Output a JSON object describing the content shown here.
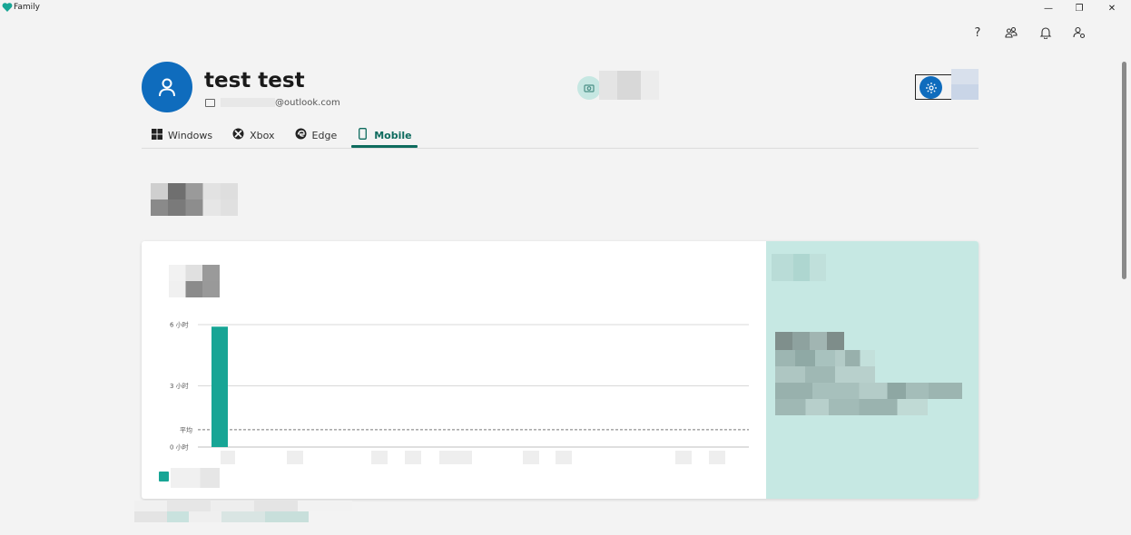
{
  "window": {
    "title": "Family",
    "minimize_glyph": "—",
    "restore_glyph": "❐",
    "close_glyph": "✕"
  },
  "top_icons": {
    "help_glyph": "?",
    "help": "help-icon",
    "family": "family-icon",
    "notifications": "bell-icon",
    "account": "account-settings-icon"
  },
  "profile": {
    "name": "test test",
    "email_suffix": "@outlook.com"
  },
  "tabs": [
    {
      "label": "Windows",
      "icon": "windows-icon",
      "glyph": "⊞"
    },
    {
      "label": "Xbox",
      "icon": "xbox-icon",
      "glyph": "⊗"
    },
    {
      "label": "Edge",
      "icon": "edge-icon",
      "glyph": "e"
    },
    {
      "label": "Mobile",
      "icon": "mobile-icon",
      "glyph": "▯",
      "active": true
    }
  ],
  "colors": {
    "accent": "#0e6b5e",
    "bar": "#17a595",
    "avatar": "#0f6cbd",
    "side_panel": "#c6e8e3"
  },
  "chart_data": {
    "type": "bar",
    "title": "",
    "xlabel": "",
    "ylabel": "",
    "ylim": [
      0,
      6
    ],
    "yticks": [
      {
        "value": 0,
        "label": "0 小时"
      },
      {
        "value": 3,
        "label": "3 小时"
      },
      {
        "value": 6,
        "label": "6 小时"
      }
    ],
    "average": {
      "label": "平均",
      "value": 0.85
    },
    "series": [
      {
        "values": [
          5.9,
          0,
          0,
          0,
          0,
          0,
          0,
          0,
          0,
          0,
          0,
          0,
          0,
          0,
          0,
          0,
          0,
          0,
          0,
          0,
          0,
          0,
          0,
          0,
          0,
          0,
          0,
          0,
          0,
          0
        ]
      }
    ],
    "grid": true
  }
}
